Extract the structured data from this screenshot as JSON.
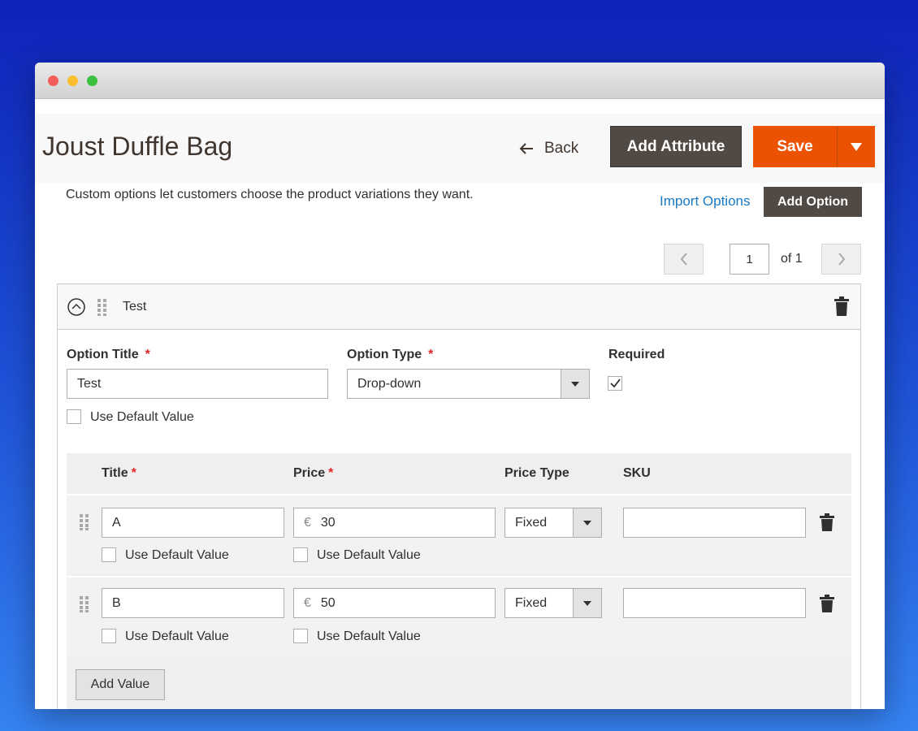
{
  "page": {
    "title": "Joust Duffle Bag",
    "back_label": "Back",
    "add_attribute_label": "Add Attribute",
    "save_label": "Save"
  },
  "custom_options": {
    "helper_text": "Custom options let customers choose the product variations they want.",
    "import_label": "Import Options",
    "add_option_label": "Add Option"
  },
  "pager": {
    "current": "1",
    "of_label": "of 1"
  },
  "option": {
    "name": "Test",
    "title_label": "Option Title",
    "title_value": "Test",
    "type_label": "Option Type",
    "type_value": "Drop-down",
    "required_label": "Required",
    "required_checked": true,
    "use_default_label": "Use Default Value",
    "required_marker": "*"
  },
  "values": {
    "columns": [
      "Title",
      "Price",
      "Price Type",
      "SKU"
    ],
    "required_marker": "*",
    "currency": "€",
    "use_default_label": "Use Default Value",
    "rows": [
      {
        "title": "A",
        "price": "30",
        "price_type": "Fixed",
        "sku": ""
      },
      {
        "title": "B",
        "price": "50",
        "price_type": "Fixed",
        "sku": ""
      }
    ],
    "add_value_label": "Add Value"
  },
  "colors": {
    "primary_dark": "#514943",
    "accent_orange": "#eb5202",
    "link_blue": "#1979c3",
    "required_red": "#e22626"
  }
}
